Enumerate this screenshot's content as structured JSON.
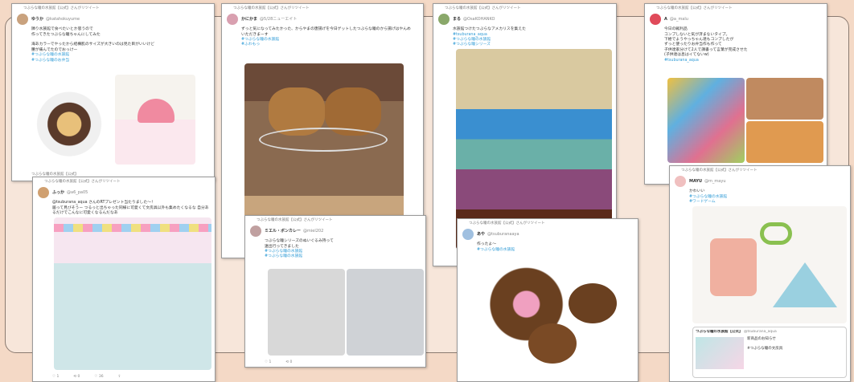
{
  "rt_label": "つぶらな瞳の水族館【公式】さんがリツイート",
  "rt_label_short": "つぶらな瞳の水族館【公式】",
  "tweets": [
    {
      "name": "ゆうか",
      "handle": "@katahokuyume",
      "text": "隣り水族館で食べたいとか思うので\n作ってきたつぶらな瞳ちゃんにしてみた\n\n海あカラーでやったから結構肌のサイズが大きいのは見た目がいいけど\n腰が痛んでたのでおっけー",
      "tags": "#つぶらな瞳の水族館\n#つぶらな瞳のお弁当",
      "footer": "つぶらな瞳の水族館【公式】"
    },
    {
      "name": "かにかま",
      "handle": "@5/28ニューエイト",
      "text": "ずっと気になってみたかった、からやまの唐揚げを今日ゲットしたつぶらな瞳のから揚げはやんめ\nいただきまーす",
      "tags": "#つぶらな瞳の水族館\n#ふわもっ"
    },
    {
      "name": "まる",
      "handle": "@OsaKOHANKO",
      "text": "水族館つけたつぶらなアメカリスを集えた",
      "tags": "#tsuburana_aqua\n#つぶらな瞳の水族館\n#つぶらな瞳シリーズ"
    },
    {
      "name": "A",
      "handle": "@a_malu",
      "text": "今日の戦利品\nコンプしないと気が済まないタイプ。\n下絵でようやっちゃん達もコンプしたが\nずっと使ったりお弁当作も作って\n子供達家分けて2人で講書って言葉が完成させた\n(子供達は息はイてないw)",
      "tags": "#tsuburana_aqua"
    },
    {
      "name": "ふっか",
      "handle": "@a6_pa05",
      "text": "@tsuburana_aqua さんのRTプレゼント当たりました〜！\n届って見びそうー つるっと出ちゃった同様に可愛くて文房具以外も集めたくなるな 自分あるだけでこんなに可愛くなるんだなあ",
      "tags": ""
    },
    {
      "name": "ミエル・ボンカレー",
      "handle": "@miel202",
      "text": "つぶらな瞳シリーズのぬいぐるみ持って\n遠出行ってきました",
      "tags": "#つぶらな瞳の水族館\n#つぶらな瞳の水族館"
    },
    {
      "name": "あや",
      "handle": "@tsuburanaaya",
      "text": "作ったよ〜",
      "tags": "#つぶらな瞳の水族館"
    },
    {
      "name": "MAYU",
      "handle": "@m_mayu",
      "text": "かわいい",
      "tags": "#つぶらな瞳の水族館\n#ワードゲーム",
      "quote_name": "つぶらな瞳の水族館【公式】",
      "quote_handle": "@tsuburana_aqua",
      "quote_text": "新商品のお知らせ\n\n#つぶらな瞳の文房具"
    }
  ],
  "actions": [
    "♡ 1",
    "⟲ 0",
    "♡ 36",
    "⇪"
  ],
  "colors": {
    "background": "#f4d9c6",
    "tag": "#2f9bd6",
    "card_border": "#9a9a9a"
  }
}
